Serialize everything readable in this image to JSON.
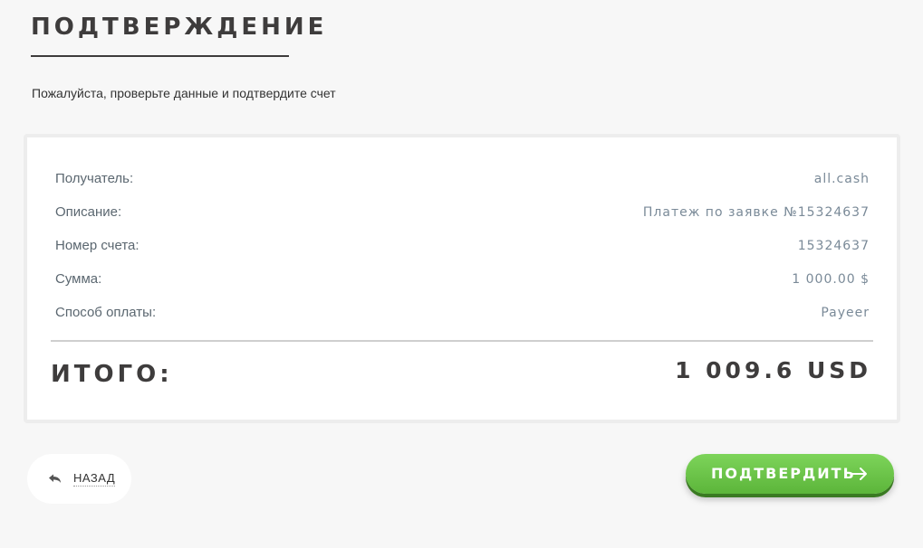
{
  "header": {
    "title": "ПОДТВЕРЖДЕНИЕ",
    "subtitle": "Пожалуйста, проверьте данные и подтвердите счет"
  },
  "details": {
    "rows": [
      {
        "label": "Получатель:",
        "value": "all.cash"
      },
      {
        "label": "Описание:",
        "value": "Платеж по заявке №15324637"
      },
      {
        "label": "Номер счета:",
        "value": "15324637"
      },
      {
        "label": "Сумма:",
        "value": "1 000.00 $"
      },
      {
        "label": "Способ оплаты:",
        "value": "Payeer"
      }
    ],
    "total_label": "ИТОГО:",
    "total_value": "1 009.6 USD"
  },
  "actions": {
    "back_label": "НАЗАД",
    "back_icon": "undo-icon",
    "confirm_label": "ПОДТВЕРДИТЬ",
    "confirm_icon": "arrow-right-icon"
  },
  "colors": {
    "accent_green": "#6ac84a",
    "text_dark": "#3e3c3c",
    "value_gray": "#7a8a98"
  }
}
